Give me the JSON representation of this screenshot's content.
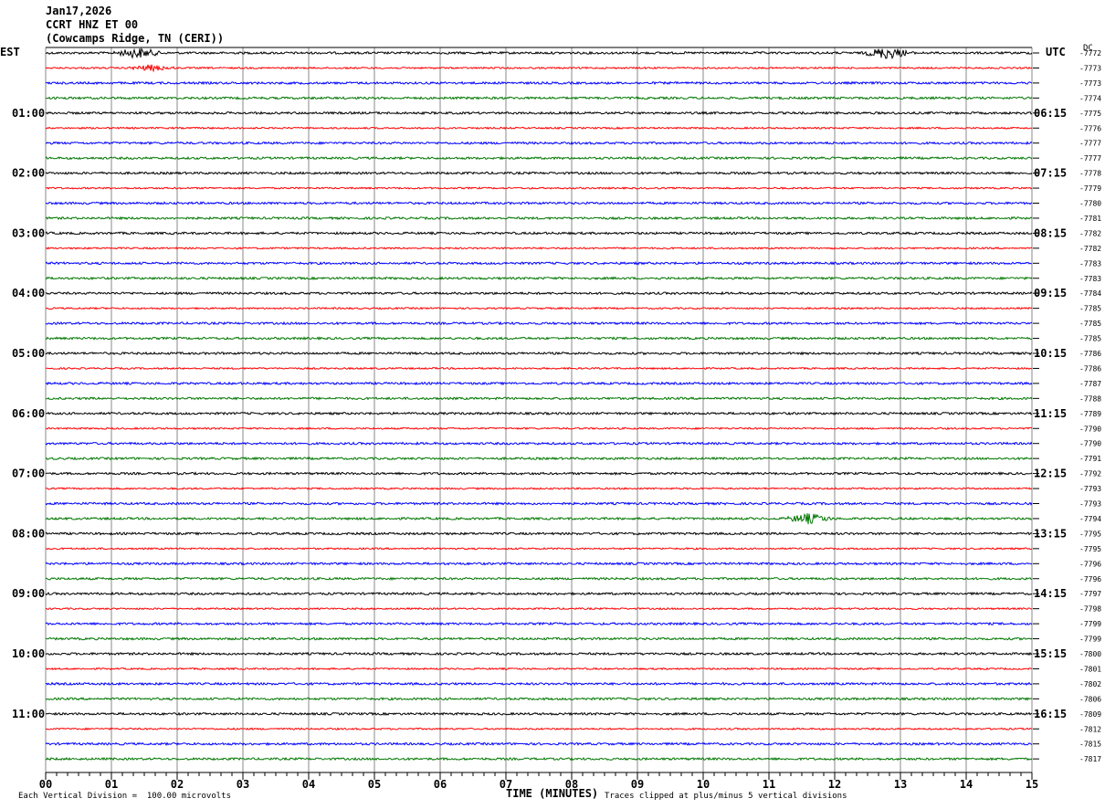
{
  "header": {
    "date": "Jan17,2026",
    "station": "CCRT HNZ ET 00",
    "location": "(Cowcamps Ridge, TN (CERI))"
  },
  "left_timezone": "EST",
  "right_timezone": "UTC",
  "right_unit": "DC",
  "xaxis_label": "TIME (MINUTES)",
  "footer_left": "Each Vertical Division =  100.00 microvolts",
  "footer_right": "Traces clipped at plus/minus 5 vertical divisions",
  "chart_data": {
    "type": "line",
    "title": "CCRT HNZ ET 00",
    "xlabel": "TIME (MINUTES)",
    "x_ticks": [
      "00",
      "01",
      "02",
      "03",
      "04",
      "05",
      "06",
      "07",
      "08",
      "09",
      "10",
      "11",
      "12",
      "13",
      "14",
      "15"
    ],
    "xlim": [
      0,
      15
    ],
    "trace_colors": [
      "#000000",
      "#ff0000",
      "#0000ff",
      "#007700"
    ],
    "est_labels": [
      "01:00",
      "02:00",
      "03:00",
      "04:00",
      "05:00",
      "06:00",
      "07:00",
      "08:00",
      "09:00",
      "10:00",
      "11:00"
    ],
    "utc_labels": [
      "06:15",
      "07:15",
      "08:15",
      "09:15",
      "10:15",
      "11:15",
      "12:15",
      "13:15",
      "14:15",
      "15:15",
      "16:15"
    ],
    "dc_offsets": [
      "-7772",
      "-7773",
      "-7773",
      "-7774",
      "-7775",
      "-7776",
      "-7777",
      "-7777",
      "-7778",
      "-7779",
      "-7780",
      "-7781",
      "-7782",
      "-7782",
      "-7783",
      "-7783",
      "-7784",
      "-7785",
      "-7785",
      "-7785",
      "-7786",
      "-7786",
      "-7787",
      "-7788",
      "-7789",
      "-7790",
      "-7790",
      "-7791",
      "-7792",
      "-7793",
      "-7793",
      "-7794",
      "-7795",
      "-7795",
      "-7796",
      "-7796",
      "-7797",
      "-7798",
      "-7799",
      "-7799",
      "-7800",
      "-7801",
      "-7802",
      "-7806",
      "-7809",
      "-7812",
      "-7815",
      "-7817"
    ],
    "events": [
      {
        "trace": 0,
        "minute": 1.4,
        "amplitude": 5
      },
      {
        "trace": 0,
        "minute": 12.8,
        "amplitude": 6
      },
      {
        "trace": 1,
        "minute": 1.6,
        "amplitude": 3
      },
      {
        "trace": 31,
        "minute": 11.6,
        "amplitude": 5
      }
    ]
  }
}
